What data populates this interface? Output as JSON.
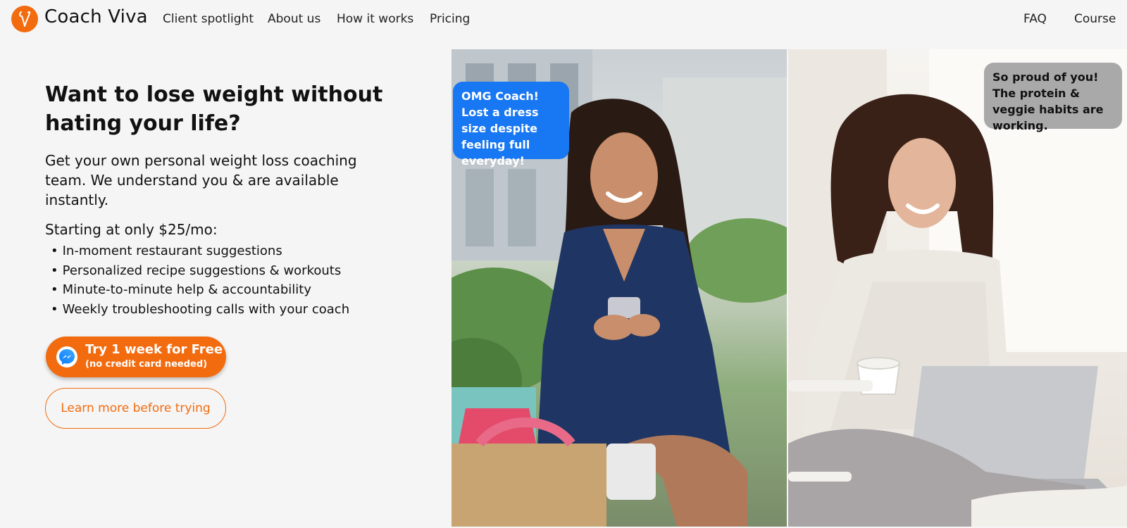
{
  "nav": {
    "brand": "Coach Viva",
    "logo_icon": "v-monogram-icon",
    "links": [
      "Client spotlight",
      "About us",
      "How it works",
      "Pricing"
    ],
    "right_links": [
      "FAQ",
      "Course"
    ]
  },
  "hero": {
    "title": "Want to lose weight without hating your life?",
    "subtitle": "Get your own personal weight loss coaching team. We understand you & are available instantly.",
    "pricing": "Starting at only $25/mo:",
    "features": [
      "In-moment restaurant suggestions",
      "Personalized recipe suggestions & workouts",
      "Minute-to-minute help & accountability",
      "Weekly troubleshooting calls with your coach"
    ]
  },
  "cta": {
    "primary_label": "Try 1 week for Free",
    "primary_note": "(no credit card needed)",
    "primary_icon": "messenger-icon",
    "secondary_label": "Learn more before trying"
  },
  "bubbles": {
    "client_message": "OMG Coach! Lost a dress size despite feeling full everyday!",
    "coach_message": "So proud of you! The protein & veggie habits are working."
  },
  "colors": {
    "brand_orange": "#f26b0f",
    "messenger_blue": "#1877f2",
    "bubble_gray": "#a9a9a9",
    "background": "#f5f5f5"
  }
}
